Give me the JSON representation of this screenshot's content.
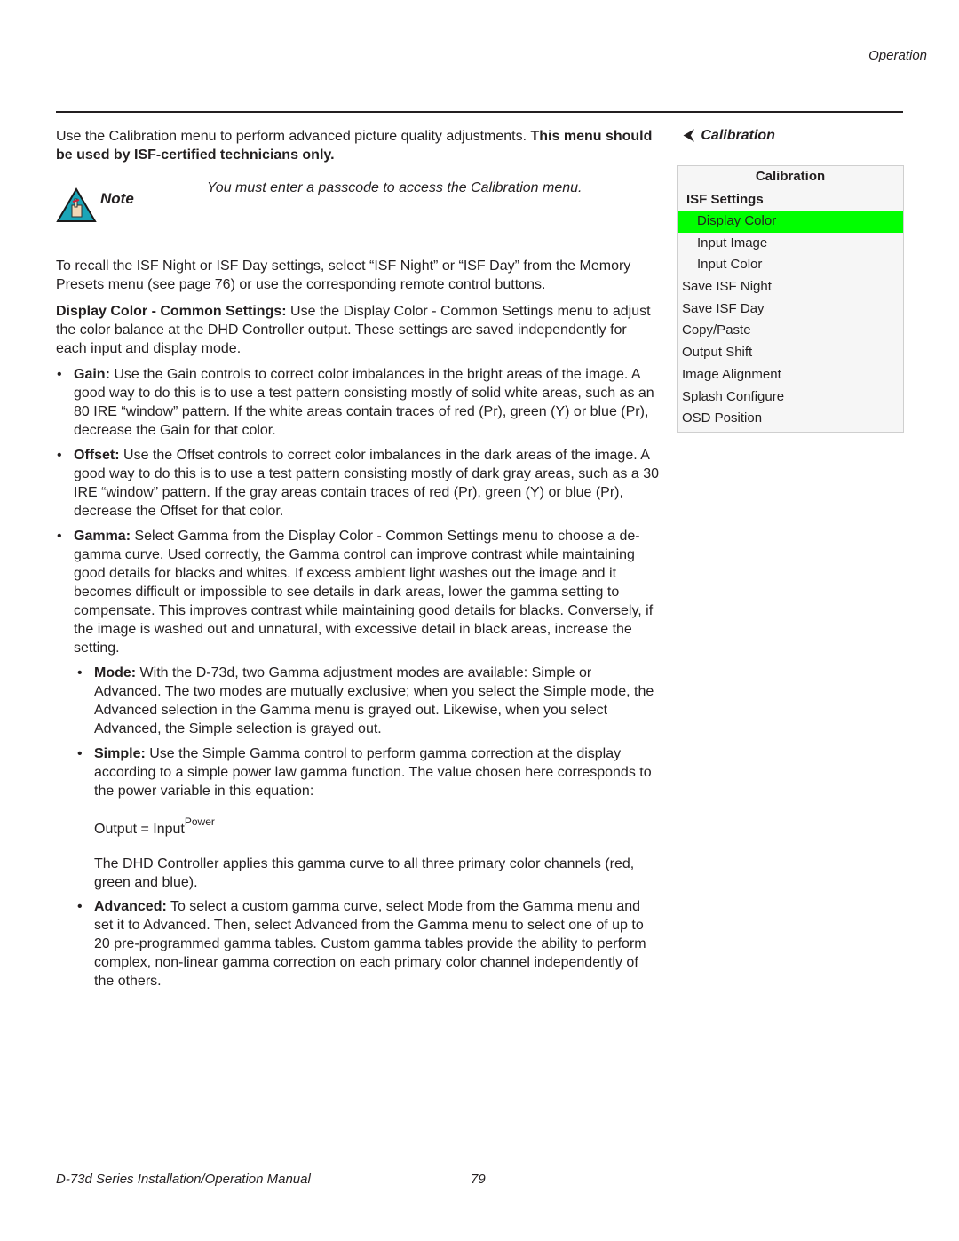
{
  "header": {
    "section": "Operation"
  },
  "main": {
    "intro_regular": "Use the Calibration menu to perform advanced picture quality adjustments. ",
    "intro_bold": "This menu should be used by ISF-certified technicians only.",
    "note": {
      "icon": "note-hand-icon",
      "label": "Note",
      "text": "You must enter a passcode to access the Calibration menu."
    },
    "recall_paragraph": "To recall the ISF Night or ISF Day settings, select “ISF Night” or “ISF Day” from the Memory Presets menu (see page 76) or use the corresponding remote control buttons.",
    "display_color": {
      "term": "Display Color - Common Settings:",
      "text": " Use the Display Color - Common Settings menu to adjust the color balance at the DHD Controller output. These settings are saved independently for each input and display mode."
    },
    "bullets": [
      {
        "term": "Gain:",
        "text": " Use the Gain controls to correct color imbalances in the bright areas of the image. A good way to do this is to use a test pattern consisting mostly of solid white areas, such as an 80 IRE “window” pattern. If the white areas contain traces of red (Pr), green (Y) or blue (Pr), decrease the Gain for that color."
      },
      {
        "term": "Offset:",
        "text": " Use the Offset controls to correct color imbalances in the dark areas of the image. A good way to do this is to use a test pattern consisting mostly of dark gray areas, such as a 30 IRE “window” pattern. If the gray areas contain traces of red (Pr), green (Y) or blue (Pr), decrease the Offset for that color."
      },
      {
        "term": "Gamma:",
        "text": " Select Gamma from the Display Color - Common Settings menu to choose a de-gamma curve. Used correctly, the Gamma control can improve contrast while maintaining good details for blacks and whites. If excess ambient light washes out the image and it becomes difficult or impossible to see details in dark areas, lower the gamma setting to compensate. This improves contrast while maintaining good details for blacks. Conversely, if the image is washed out and unnatural, with excessive detail in black areas, increase the setting."
      }
    ],
    "sub_bullets": [
      {
        "term": "Mode:",
        "text": " With the D-73d, two Gamma adjustment modes are available: Simple or Advanced. The two modes are mutually exclusive; when you select the Simple mode, the Advanced selection in the Gamma menu is grayed out. Likewise, when you select Advanced, the Simple selection is grayed out."
      },
      {
        "term": "Simple:",
        "text": " Use the Simple Gamma control to perform gamma correction at the display according to a simple power law gamma function. The value chosen here corresponds to the power variable in this equation:"
      }
    ],
    "formula": {
      "base": "Output = Input",
      "exponent": "Power"
    },
    "applies_text": "The DHD Controller applies this gamma curve to all three primary color channels (red, green and blue).",
    "advanced": {
      "term": "Advanced:",
      "text": " To select a custom gamma curve, select Mode from the Gamma menu and set it to Advanced. Then, select Advanced from the Gamma menu to select one of up to 20 pre-programmed gamma tables. Custom gamma tables provide the ability to perform complex, non-linear gamma correction on each primary color channel independently of the others."
    }
  },
  "sidebar": {
    "title": "Calibration",
    "arrow_icon": "left-arrow-icon",
    "menu": {
      "header": "Calibration",
      "section": "ISF Settings",
      "selected_color": "#00ff00",
      "items": [
        {
          "label": "Display Color",
          "indent": true,
          "selected": true
        },
        {
          "label": "Input Image",
          "indent": true,
          "selected": false
        },
        {
          "label": "Input Color",
          "indent": true,
          "selected": false
        },
        {
          "label": "Save ISF Night",
          "indent": false,
          "selected": false
        },
        {
          "label": "Save ISF Day",
          "indent": false,
          "selected": false
        },
        {
          "label": "Copy/Paste",
          "indent": false,
          "selected": false
        },
        {
          "label": "Output Shift",
          "indent": false,
          "selected": false
        },
        {
          "label": "Image Alignment",
          "indent": false,
          "selected": false
        },
        {
          "label": "Splash Configure",
          "indent": false,
          "selected": false
        },
        {
          "label": "OSD Position",
          "indent": false,
          "selected": false
        }
      ]
    }
  },
  "footer": {
    "title": "D-73d Series Installation/Operation Manual",
    "page": "79"
  }
}
